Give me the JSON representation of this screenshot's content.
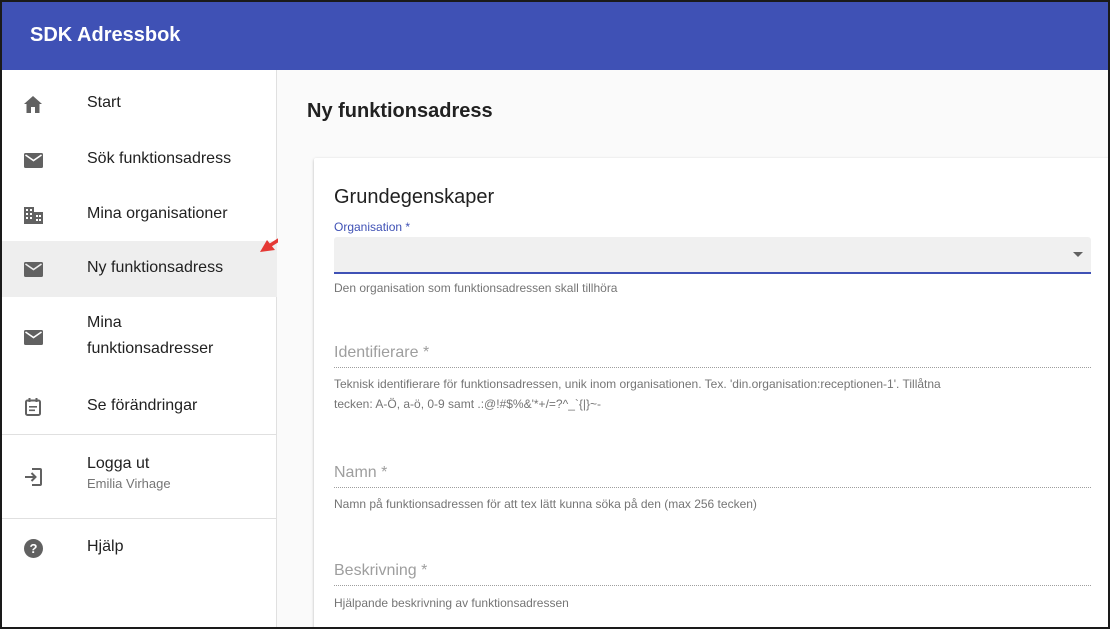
{
  "app": {
    "title": "SDK Adressbok"
  },
  "sidebar": {
    "items": [
      {
        "label": "Start",
        "icon": "home-icon"
      },
      {
        "label": "Sök funktionsadress",
        "icon": "mail-icon"
      },
      {
        "label": "Mina organisationer",
        "icon": "business-icon"
      },
      {
        "label": "Ny funktionsadress",
        "icon": "mail-icon",
        "active": true
      },
      {
        "label": "Mina\nfunktionsadresser",
        "label_line1": "Mina",
        "label_line2": "funktionsadresser",
        "icon": "mail-icon"
      },
      {
        "label": "Se förändringar",
        "icon": "event-note-icon"
      },
      {
        "label": "Logga ut",
        "sublabel": "Emilia Virhage",
        "icon": "logout-icon"
      },
      {
        "label": "Hjälp",
        "icon": "help-icon"
      }
    ]
  },
  "main": {
    "page_title": "Ny funktionsadress",
    "section_title": "Grundegenskaper",
    "organisation": {
      "label": "Organisation *",
      "value": "",
      "hint": "Den organisation som funktionsadressen skall tillhöra"
    },
    "identifierare": {
      "placeholder": "Identifierare *",
      "hint_line1": "Teknisk identifierare för funktionsadressen, unik inom organisationen. Tex. 'din.organisation:receptionen-1'. Tillåtna",
      "hint_line2": "tecken: A-Ö, a-ö, 0-9 samt .:@!#$%&'*+/=?^_`{|}~-"
    },
    "namn": {
      "placeholder": "Namn *",
      "hint": "Namn på funktionsadressen för att tex lätt kunna söka på den (max 256 tecken)"
    },
    "beskrivning": {
      "placeholder": "Beskrivning *",
      "hint": "Hjälpande beskrivning av funktionsadressen"
    }
  },
  "colors": {
    "appbar": "#3f51b5",
    "accent": "#3f51b5",
    "annotation_arrow": "#e53935"
  }
}
